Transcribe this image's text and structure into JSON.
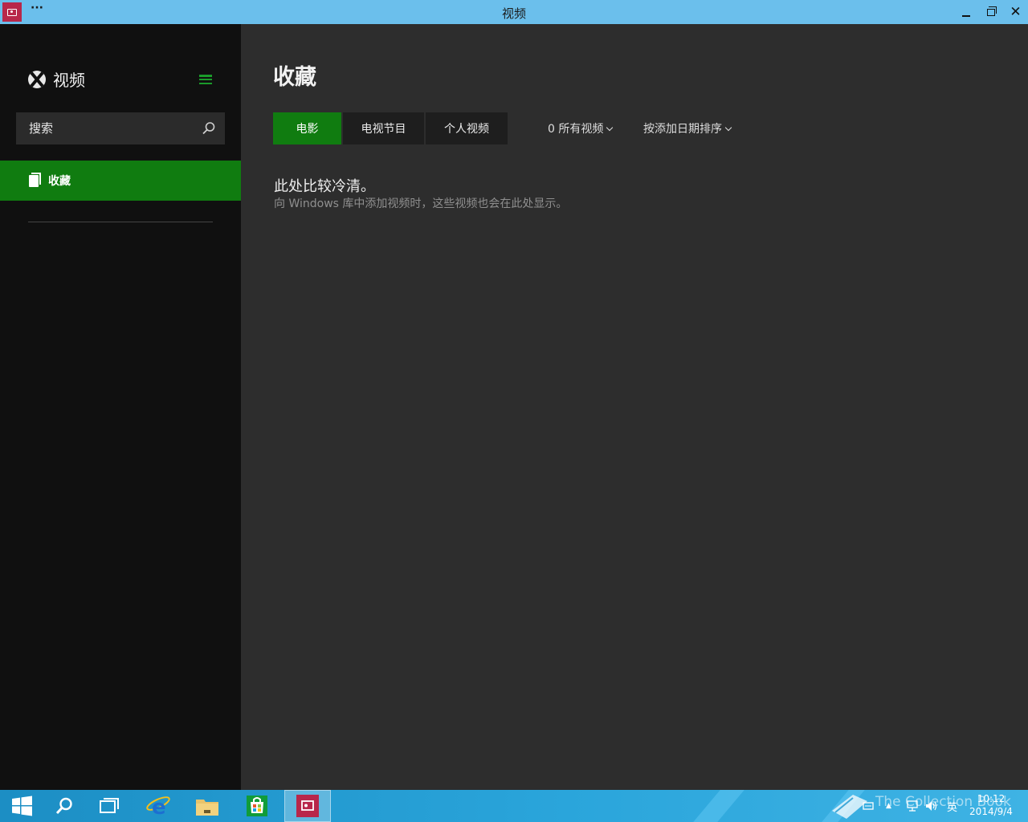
{
  "window": {
    "title": "视频",
    "more_label": "···"
  },
  "sidebar": {
    "brand_label": "视频",
    "search": {
      "placeholder": "搜索",
      "value": ""
    },
    "items": [
      {
        "label": "收藏",
        "icon": "document-stack-icon",
        "active": true
      }
    ]
  },
  "main": {
    "page_title": "收藏",
    "tabs": [
      {
        "label": "电影",
        "active": true
      },
      {
        "label": "电视节目",
        "active": false
      },
      {
        "label": "个人视频",
        "active": false
      }
    ],
    "filters": {
      "count_filter": "0 所有视频",
      "sort": "按添加日期排序"
    },
    "empty_state": {
      "title": "此处比较冷清。",
      "description": "向 Windows 库中添加视频时，这些视频也会在此处显示。"
    }
  },
  "taskbar": {
    "apps": [
      {
        "name": "start",
        "icon": "windows-logo-icon"
      },
      {
        "name": "search",
        "icon": "search-icon"
      },
      {
        "name": "task-view",
        "icon": "task-view-icon"
      },
      {
        "name": "internet-explorer",
        "icon": "ie-icon"
      },
      {
        "name": "file-explorer",
        "icon": "folder-icon"
      },
      {
        "name": "store",
        "icon": "store-icon"
      },
      {
        "name": "video",
        "icon": "video-app-icon",
        "active": true
      }
    ],
    "tray": {
      "ime": "英",
      "time": "10:12",
      "date": "2014/9/4",
      "watermark": "The Collection Book"
    }
  },
  "colors": {
    "titlebar": "#6bbfec",
    "accent_green": "#107c10",
    "sidebar_bg": "#101010",
    "main_bg": "#2d2d2d",
    "app_icon": "#b8274a"
  }
}
